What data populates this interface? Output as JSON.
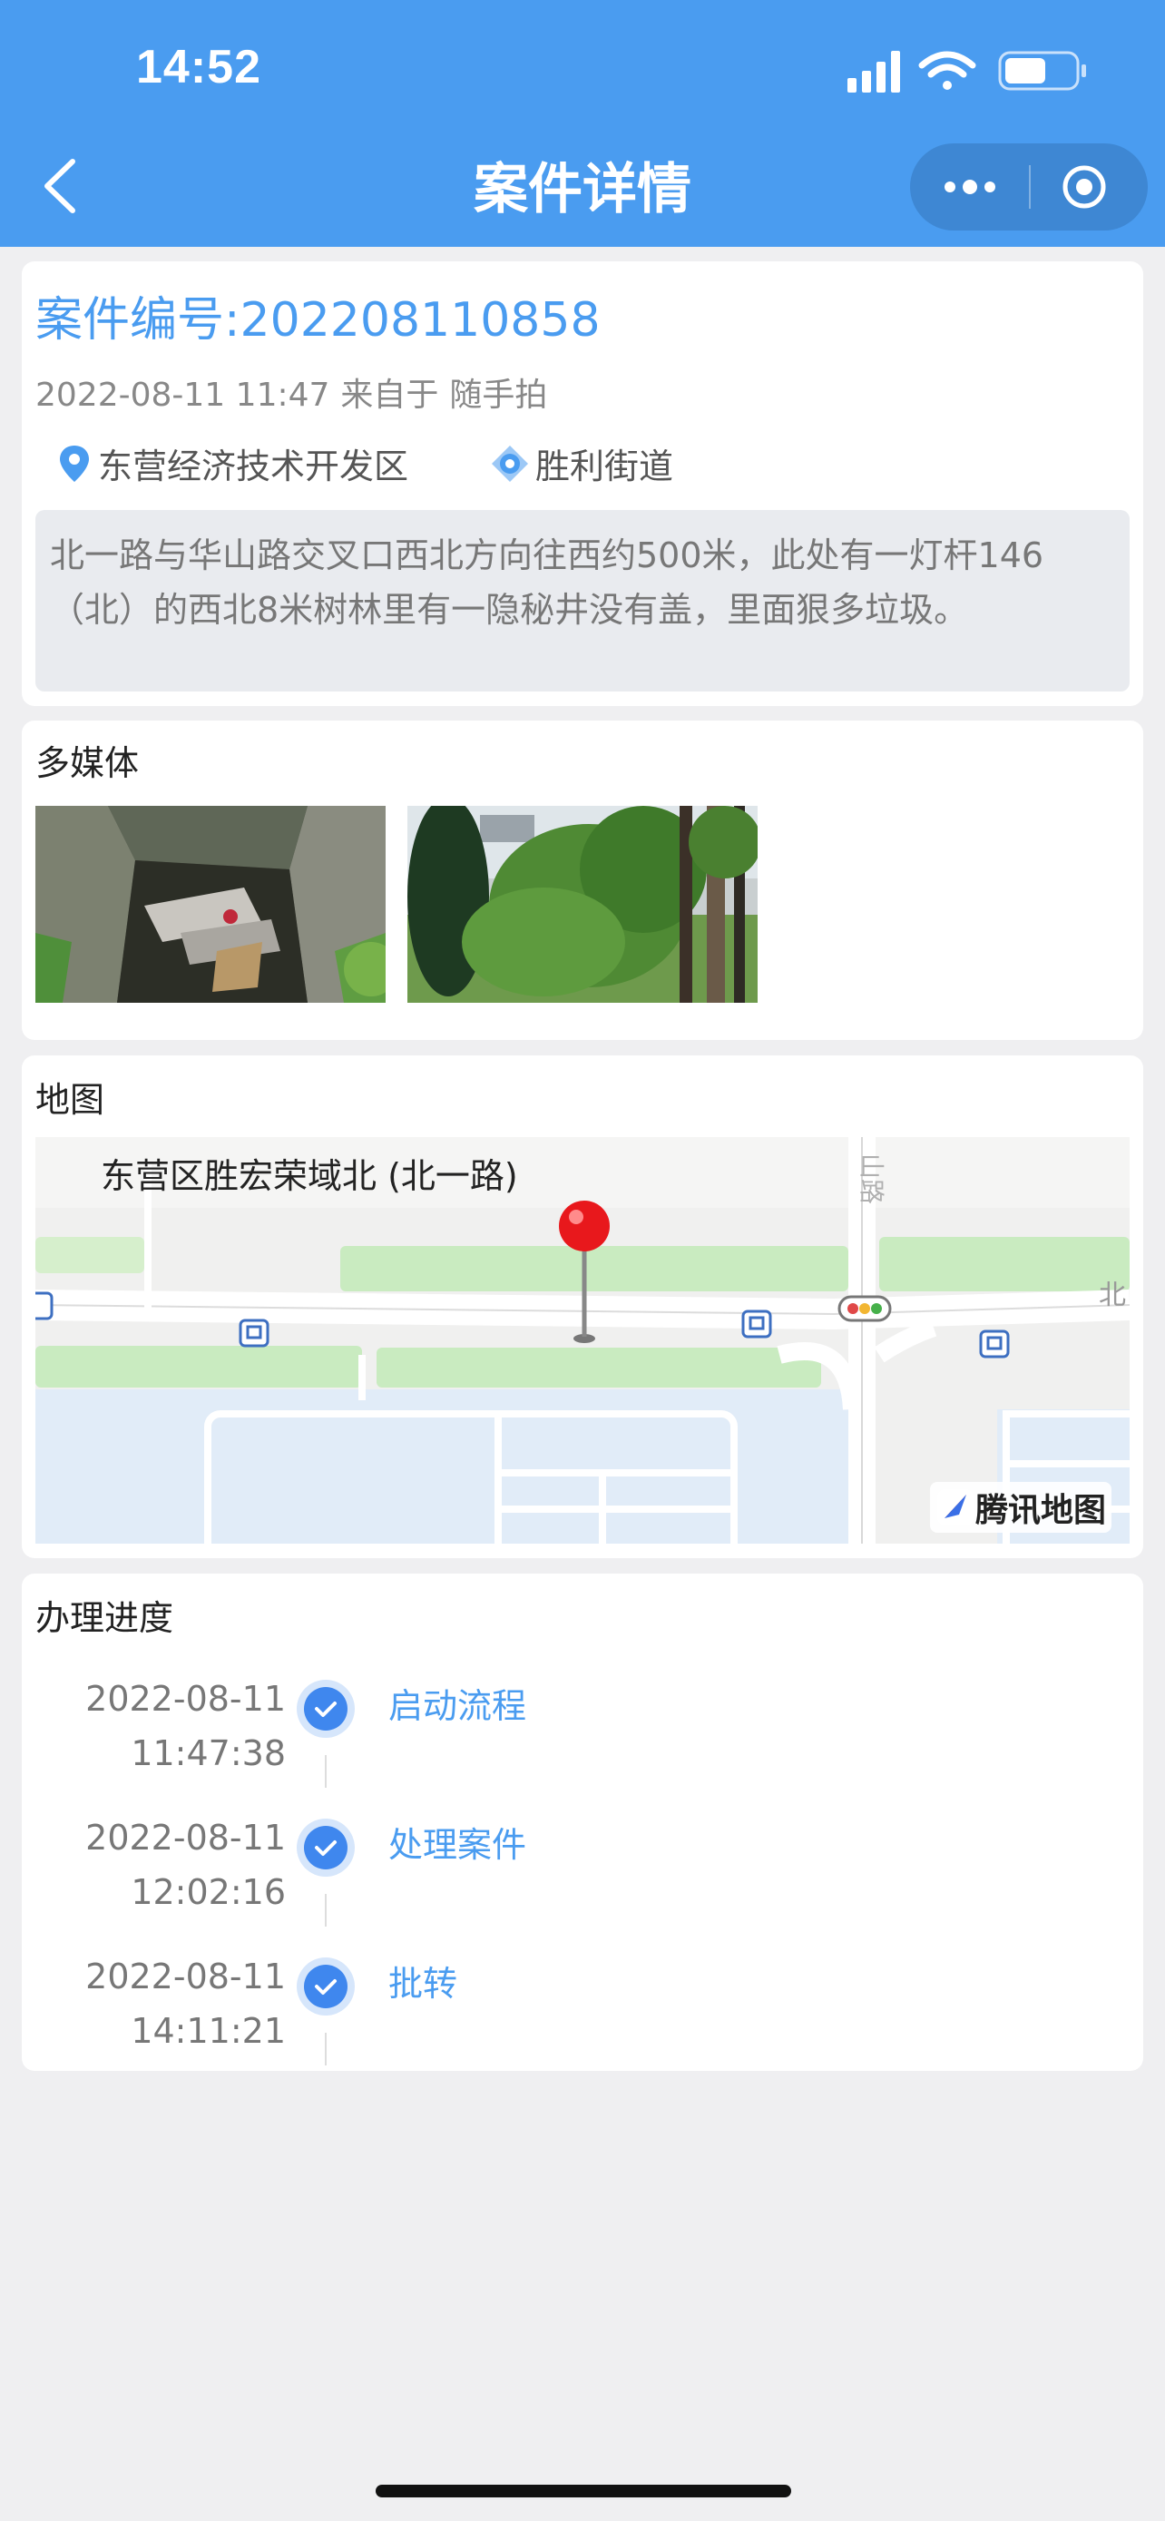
{
  "status_bar": {
    "time": "14:52"
  },
  "nav": {
    "title": "案件详情"
  },
  "case": {
    "number_label": "案件编号:202208110858",
    "datetime": "2022-08-11 11:47",
    "source_prefix": "来自于",
    "source": "随手拍",
    "district": "东营经济技术开发区",
    "street": "胜利街道",
    "description": "北一路与华山路交叉口西北方向往西约500米，此处有一灯杆146（北）的西北8米树林里有一隐秘井没有盖，里面狠多垃圾。"
  },
  "media": {
    "heading": "多媒体"
  },
  "map": {
    "heading": "地图",
    "place_name": "东营区胜宏荣域北 (北一路)",
    "logo_text": "腾讯地图",
    "road_labels": {
      "vertical": "山路",
      "horizontal": "北"
    }
  },
  "progress": {
    "heading": "办理进度",
    "steps": [
      {
        "date": "2022-08-11",
        "time": "11:47:38",
        "label": "启动流程"
      },
      {
        "date": "2022-08-11",
        "time": "12:02:16",
        "label": "处理案件"
      },
      {
        "date": "2022-08-11",
        "time": "14:11:21",
        "label": "批转"
      }
    ]
  },
  "colors": {
    "accent": "#4a9cf0",
    "nav_bg": "#4a9cf0",
    "page_bg": "#efeff1"
  }
}
